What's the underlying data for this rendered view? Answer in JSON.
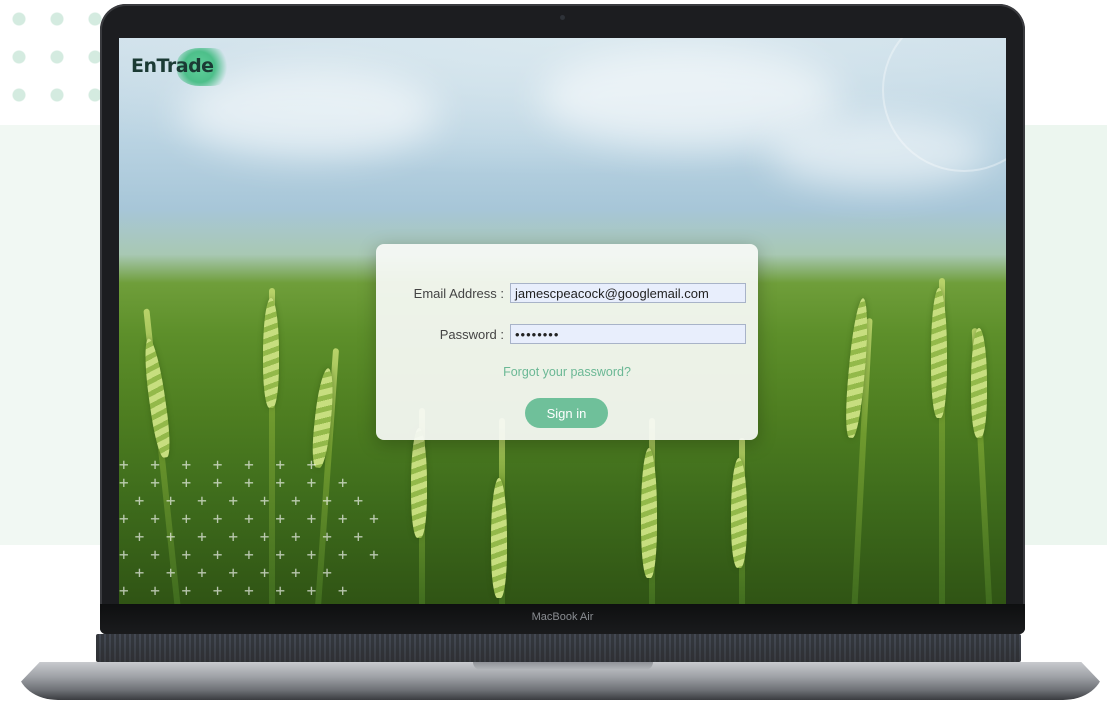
{
  "brand": {
    "logo_text": "EnTrade"
  },
  "login": {
    "email_label": "Email Address  :",
    "email_value": "jamescpeacock@googlemail.com",
    "password_label": "Password :",
    "password_value": "••••••••",
    "forgot_link": "Forgot your password?",
    "sign_in_button": "Sign in"
  },
  "device": {
    "model_label": "MacBook Air"
  },
  "colors": {
    "accent": "#6fc09a",
    "logo_dark": "#1b3a34",
    "field_bg": "#e8eefc"
  },
  "icons": {
    "camera": "camera-icon"
  }
}
